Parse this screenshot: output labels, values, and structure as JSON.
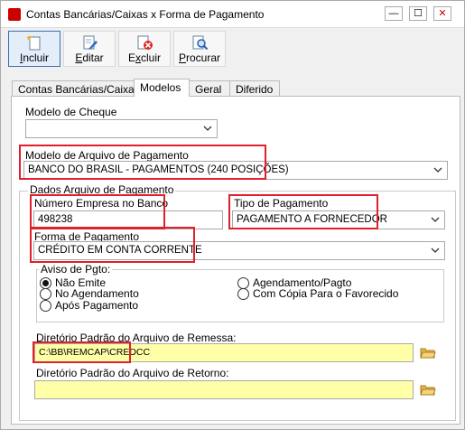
{
  "window": {
    "title": "Contas Bancárias/Caixas x Forma de Pagamento",
    "minimize_glyph": "—",
    "maximize_glyph": "☐",
    "close_glyph": "✕"
  },
  "toolbar": {
    "incluir": {
      "label_prefix": "",
      "label_underline": "I",
      "label_rest": "ncluir",
      "icon": "new-document-icon"
    },
    "editar": {
      "label_prefix": "",
      "label_underline": "E",
      "label_rest": "ditar",
      "icon": "edit-icon"
    },
    "excluir": {
      "label_prefix": "E",
      "label_underline": "x",
      "label_rest": "cluir",
      "icon": "delete-icon"
    },
    "procurar": {
      "label_prefix": "",
      "label_underline": "P",
      "label_rest": "rocurar",
      "icon": "search-icon"
    }
  },
  "tabs": [
    {
      "label": "Contas Bancárias/Caixas"
    },
    {
      "label": "Modelos"
    },
    {
      "label": "Geral"
    },
    {
      "label": "Diferido"
    }
  ],
  "form": {
    "modelo_cheque": {
      "label": "Modelo de Cheque",
      "value": ""
    },
    "modelo_arquivo": {
      "label": "Modelo de Arquivo de Pagamento",
      "value": "BANCO DO BRASIL - PAGAMENTOS (240 POSIÇÕES)"
    },
    "dados_group_label": "Dados Arquivo de Pagamento",
    "numero_empresa": {
      "label": "Número Empresa no Banco",
      "value": "498238"
    },
    "tipo_pagamento": {
      "label": "Tipo de Pagamento",
      "value": "PAGAMENTO A FORNECEDOR"
    },
    "forma_pagamento": {
      "label": "Forma de Pagamento",
      "value": "CRÉDITO EM CONTA CORRENTE"
    },
    "aviso": {
      "label": "Aviso de Pgto:",
      "options": [
        {
          "label": "Não Emite",
          "selected": true
        },
        {
          "label": "No Agendamento",
          "selected": false
        },
        {
          "label": "Após Pagamento",
          "selected": false
        },
        {
          "label": "Agendamento/Pagto",
          "selected": false
        },
        {
          "label": "Com Cópia Para o Favorecido",
          "selected": false
        }
      ]
    },
    "dir_remessa": {
      "label": "Diretório Padrão do Arquivo de Remessa:",
      "value": "C:\\BB\\REMCAP\\CREDCC"
    },
    "dir_retorno": {
      "label": "Diretório Padrão do Arquivo de Retorno:",
      "value": ""
    }
  },
  "colors": {
    "highlight_border": "#e0202a",
    "field_yellow": "#ffffa8",
    "active_button": "#3a6fb0"
  }
}
